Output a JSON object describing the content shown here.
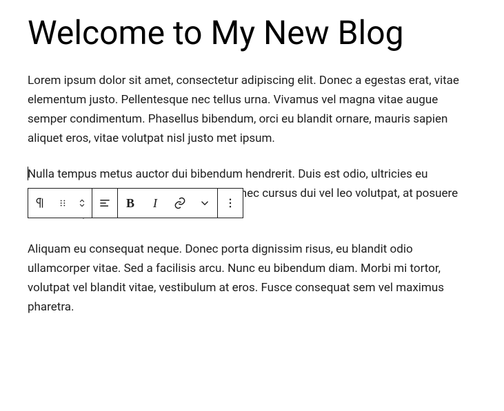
{
  "title": "Welcome to My New Blog",
  "paragraphs": {
    "p1": "Lorem ipsum dolor sit amet, consectetur adipiscing elit. Donec a egestas erat, vitae elementum justo. Pellentesque nec tellus urna. Vivamus vel magna vitae augue semper condimentum. Phasellus bibendum, orci eu blandit ornare, mauris sapien aliquet eros, vitae volutpat nisl justo met ipsum.",
    "p2": "Nulla tempus metus auctor dui bibendum hendrerit. Duis est odio, ultricies eu hendrerit posuere, euismod quis odio. Donec cursus dui vel leo volutpat, at posuere est consequat.",
    "p3": "Aliquam eu consequat neque. Donec porta dignissim risus, eu blandit odio ullamcorper vitae. Sed a facilisis arcu. Nunc eu bibendum diam. Morbi mi tortor, volutpat vel blandit vitae, vestibulum at eros. Fusce consequat sem vel maximus pharetra."
  },
  "toolbar": {
    "block_type": "paragraph",
    "drag": "drag",
    "move": "move-up-down",
    "align": "align-left",
    "bold": "B",
    "italic": "I",
    "link": "link",
    "more_rich": "more-rich-text",
    "options": "options"
  }
}
